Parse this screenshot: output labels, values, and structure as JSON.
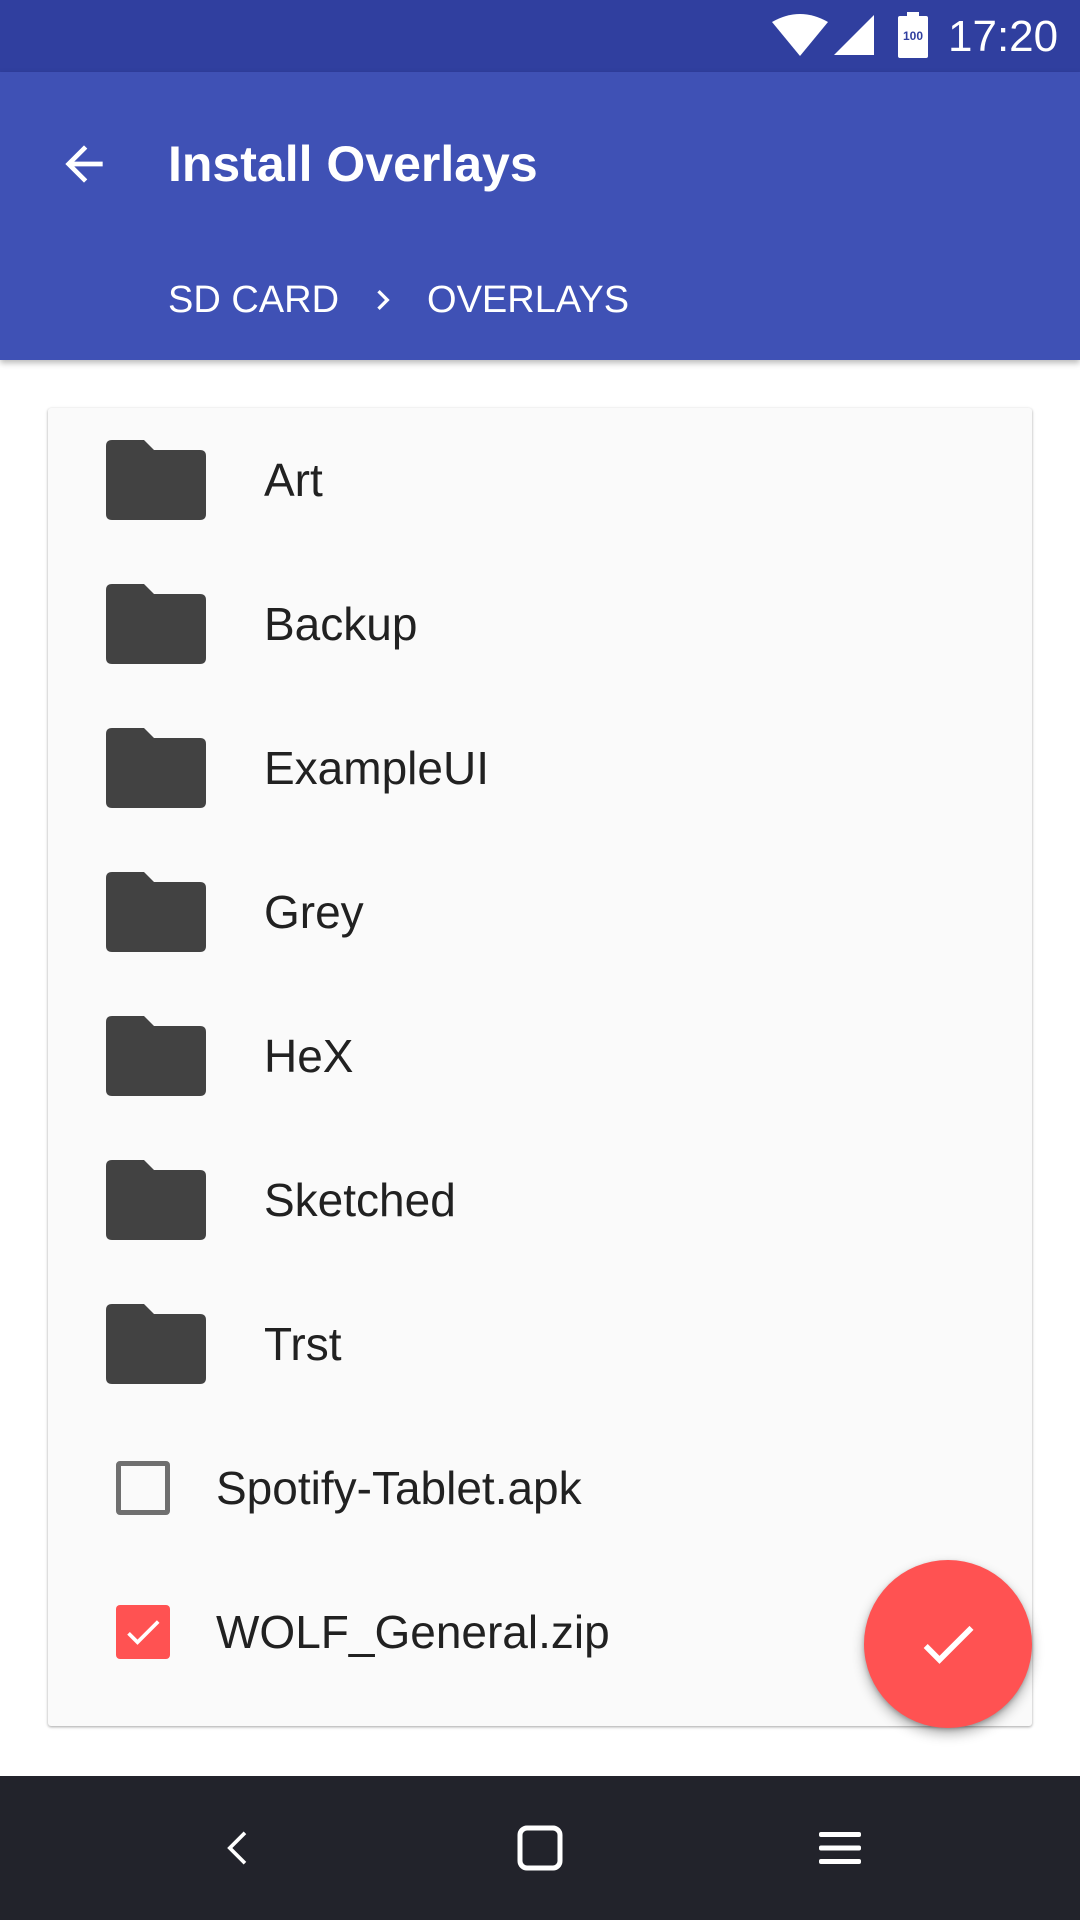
{
  "status_bar": {
    "time": "17:20",
    "battery_level": "100",
    "icons": [
      "wifi-icon",
      "signal-icon",
      "battery-icon"
    ]
  },
  "toolbar": {
    "title": "Install Overlays",
    "back_icon": "arrow-back-icon",
    "background_color": "#3f51b5"
  },
  "breadcrumb": {
    "items": [
      "SD CARD",
      "OVERLAYS"
    ],
    "separator_icon": "chevron-right-icon"
  },
  "list": {
    "folders": [
      {
        "name": "Art",
        "icon": "folder-icon"
      },
      {
        "name": "Backup",
        "icon": "folder-icon"
      },
      {
        "name": "ExampleUI",
        "icon": "folder-icon"
      },
      {
        "name": "Grey",
        "icon": "folder-icon"
      },
      {
        "name": "HeX",
        "icon": "folder-icon"
      },
      {
        "name": "Sketched",
        "icon": "folder-icon"
      },
      {
        "name": "Trst",
        "icon": "folder-icon"
      }
    ],
    "files": [
      {
        "name": "Spotify-Tablet.apk",
        "checked": false
      },
      {
        "name": "WOLF_General.zip",
        "checked": true
      }
    ]
  },
  "fab": {
    "icon": "check-icon",
    "color": "#ff5252"
  },
  "nav_bar": {
    "buttons": [
      "back-icon",
      "home-icon",
      "menu-icon"
    ]
  },
  "colors": {
    "status_bar": "#303f9f",
    "toolbar": "#3f51b5",
    "accent": "#ff5252",
    "folder": "#424242",
    "nav_bar": "#22232b"
  }
}
